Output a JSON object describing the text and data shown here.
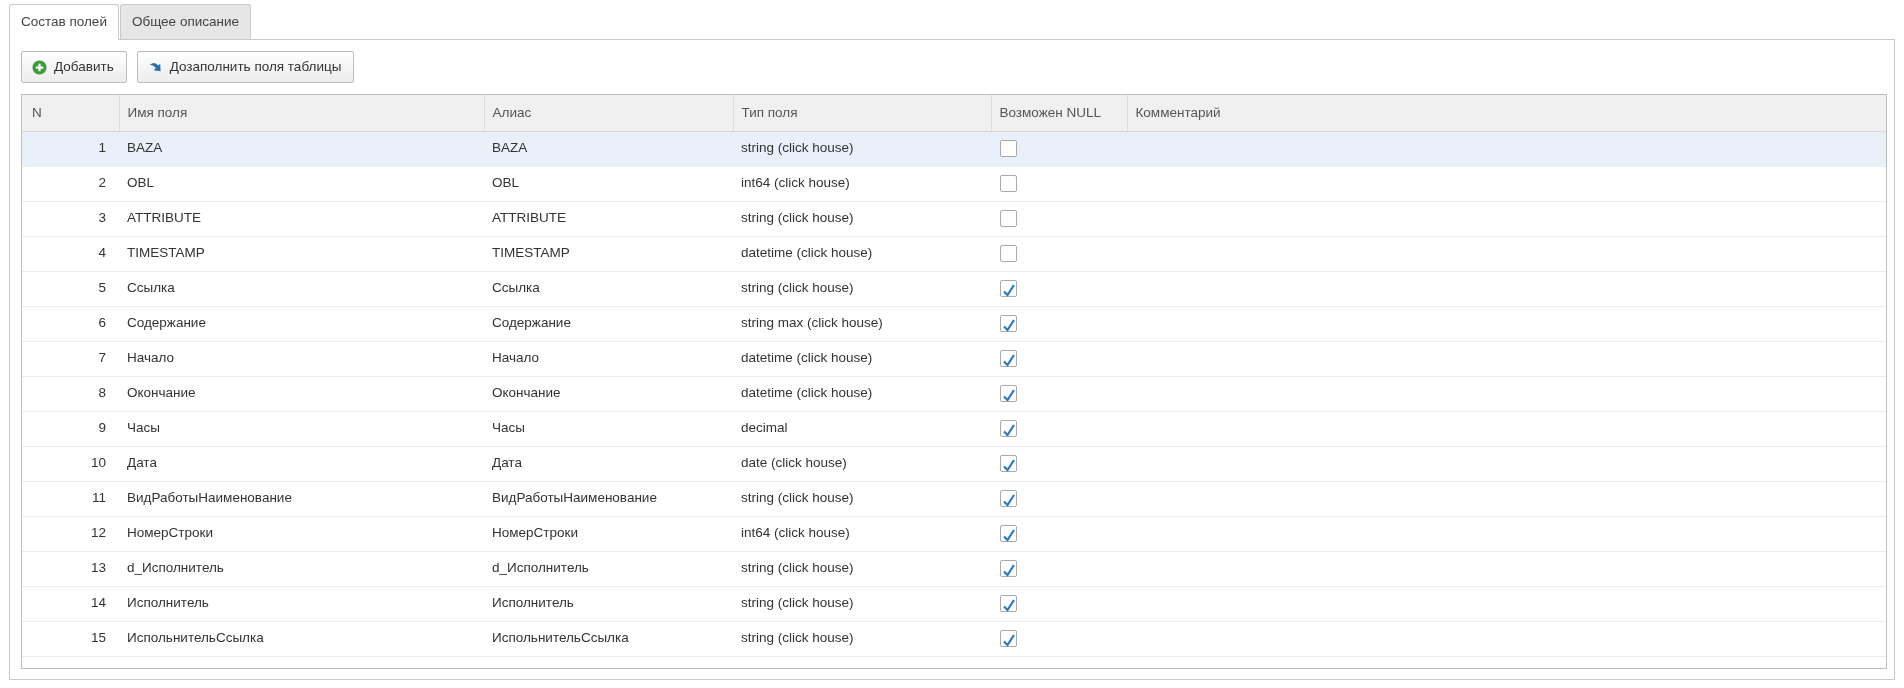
{
  "tabs": [
    {
      "label": "Состав полей",
      "selected": true
    },
    {
      "label": "Общее описание",
      "selected": false
    }
  ],
  "toolbar": [
    {
      "label": "Добавить",
      "kind": "add"
    },
    {
      "label": "Дозаполнить поля таблицы",
      "kind": "fill"
    }
  ],
  "table": {
    "columns": [
      "N",
      "Имя поля",
      "Алиас",
      "Тип поля",
      "Возможен NULL",
      "Комментарий"
    ],
    "rows": [
      {
        "n": "1",
        "name": "BAZA",
        "alias": "BAZA",
        "type": "string (click house)",
        "nullable": false,
        "selected": true
      },
      {
        "n": "2",
        "name": "OBL",
        "alias": "OBL",
        "type": "int64 (click house)",
        "nullable": false,
        "selected": false
      },
      {
        "n": "3",
        "name": "ATTRIBUTE",
        "alias": "ATTRIBUTE",
        "type": "string (click house)",
        "nullable": false,
        "selected": false
      },
      {
        "n": "4",
        "name": "TIMESTAMP",
        "alias": "TIMESTAMP",
        "type": "datetime (click house)",
        "nullable": false,
        "selected": false
      },
      {
        "n": "5",
        "name": "Ссылка",
        "alias": "Ссылка",
        "type": "string (click house)",
        "nullable": true,
        "selected": false
      },
      {
        "n": "6",
        "name": "Содержание",
        "alias": "Содержание",
        "type": "string max (click house)",
        "nullable": true,
        "selected": false
      },
      {
        "n": "7",
        "name": "Начало",
        "alias": "Начало",
        "type": "datetime (click house)",
        "nullable": true,
        "selected": false
      },
      {
        "n": "8",
        "name": "Окончание",
        "alias": "Окончание",
        "type": "datetime (click house)",
        "nullable": true,
        "selected": false
      },
      {
        "n": "9",
        "name": "Часы",
        "alias": "Часы",
        "type": "decimal",
        "nullable": true,
        "selected": false
      },
      {
        "n": "10",
        "name": "Дата",
        "alias": "Дата",
        "type": "date (click house)",
        "nullable": true,
        "selected": false
      },
      {
        "n": "11",
        "name": "ВидРаботыНаименование",
        "alias": "ВидРаботыНаименование",
        "type": "string (click house)",
        "nullable": true,
        "selected": false
      },
      {
        "n": "12",
        "name": "НомерСтроки",
        "alias": "НомерСтроки",
        "type": "int64 (click house)",
        "nullable": true,
        "selected": false
      },
      {
        "n": "13",
        "name": "d_Исполнитель",
        "alias": "d_Исполнитель",
        "type": "string (click house)",
        "nullable": true,
        "selected": false
      },
      {
        "n": "14",
        "name": "Исполнитель",
        "alias": "Исполнитель",
        "type": "string (click house)",
        "nullable": true,
        "selected": false
      },
      {
        "n": "15",
        "name": "ИспольнительСсылка",
        "alias": "ИспольнительСсылка",
        "type": "string (click house)",
        "nullable": true,
        "selected": false
      }
    ]
  }
}
